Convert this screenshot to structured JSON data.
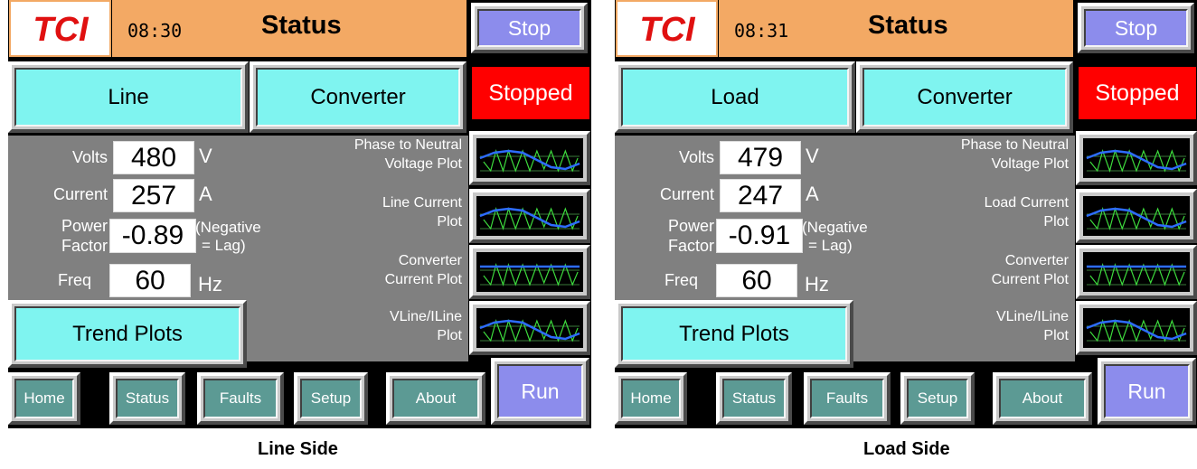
{
  "panels": [
    {
      "logo_text": "TCI",
      "clock": "08:30",
      "title": "Status",
      "stop_label": "Stop",
      "source_button": "Line",
      "converter_button": "Converter",
      "status_indicator": "Stopped",
      "status_color": "#ff0000",
      "volts_label": "Volts",
      "volts_value": "480",
      "volts_unit": "V",
      "current_label": "Current",
      "current_value": "257",
      "current_unit": "A",
      "pf_label_line1": "Power",
      "pf_label_line2": "Factor",
      "pf_value": "-0.89",
      "pf_note_line1": "(Negative",
      "pf_note_line2": "= Lag)",
      "freq_label": "Freq",
      "freq_value": "60",
      "freq_unit": "Hz",
      "plots": [
        {
          "line1": "Phase to Neutral",
          "line2": "Voltage Plot",
          "icon": "waveform-icon"
        },
        {
          "line1": "Line Current",
          "line2": "Plot",
          "icon": "waveform-icon"
        },
        {
          "line1": "Converter",
          "line2": "Current Plot",
          "icon": "waveform-icon"
        },
        {
          "line1": "VLine/ILine",
          "line2": "Plot",
          "icon": "waveform-icon"
        }
      ],
      "trend_button": "Trend Plots",
      "nav": [
        "Home",
        "Status",
        "Faults",
        "Setup",
        "About"
      ],
      "run_label": "Run",
      "caption": "Line Side"
    },
    {
      "logo_text": "TCI",
      "clock": "08:31",
      "title": "Status",
      "stop_label": "Stop",
      "source_button": "Load",
      "converter_button": "Converter",
      "status_indicator": "Stopped",
      "status_color": "#ff0000",
      "volts_label": "Volts",
      "volts_value": "479",
      "volts_unit": "V",
      "current_label": "Current",
      "current_value": "247",
      "current_unit": "A",
      "pf_label_line1": "Power",
      "pf_label_line2": "Factor",
      "pf_value": "-0.91",
      "pf_note_line1": "(Negative",
      "pf_note_line2": "= Lag)",
      "freq_label": "Freq",
      "freq_value": "60",
      "freq_unit": "Hz",
      "plots": [
        {
          "line1": "Phase to Neutral",
          "line2": "Voltage Plot",
          "icon": "waveform-icon"
        },
        {
          "line1": "Load Current",
          "line2": "Plot",
          "icon": "waveform-icon"
        },
        {
          "line1": "Converter",
          "line2": "Current Plot",
          "icon": "waveform-icon"
        },
        {
          "line1": "VLine/ILine",
          "line2": "Plot",
          "icon": "waveform-icon"
        }
      ],
      "trend_button": "Trend Plots",
      "nav": [
        "Home",
        "Status",
        "Faults",
        "Setup",
        "About"
      ],
      "run_label": "Run",
      "caption": "Load Side"
    }
  ],
  "colors": {
    "header": "#f3a964",
    "button_cyan": "#7ff4f0",
    "button_lavender": "#8c8cec",
    "nav_teal": "#5c9a94",
    "logo_red": "#e01010",
    "panel_gray": "#808080"
  }
}
